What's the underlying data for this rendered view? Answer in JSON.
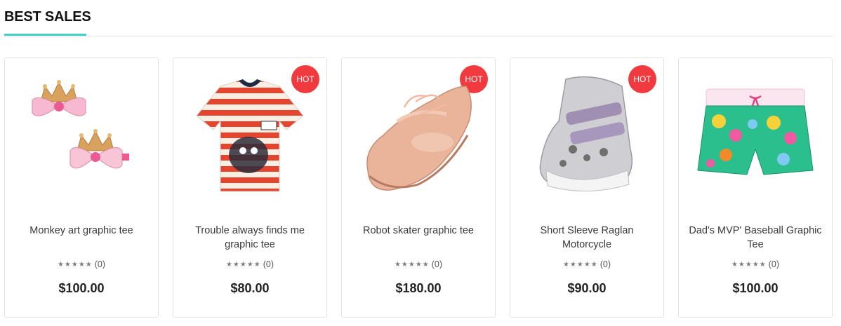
{
  "section": {
    "title": "BEST SALES"
  },
  "products": [
    {
      "name": "Monkey art graphic tee",
      "rating": "★★★★★",
      "count": "(0)",
      "price": "$100.00",
      "badge": ""
    },
    {
      "name": "Trouble always finds me graphic tee",
      "rating": "★★★★★",
      "count": "(0)",
      "price": "$80.00",
      "badge": "HOT"
    },
    {
      "name": "Robot skater graphic tee",
      "rating": "★★★★★",
      "count": "(0)",
      "price": "$180.00",
      "badge": "HOT"
    },
    {
      "name": "Short Sleeve Raglan Motorcycle",
      "rating": "★★★★★",
      "count": "(0)",
      "price": "$90.00",
      "badge": "HOT"
    },
    {
      "name": "Dad's MVP' Baseball Graphic Tee",
      "rating": "★★★★★",
      "count": "(0)",
      "price": "$100.00",
      "badge": ""
    }
  ],
  "colors": {
    "accent": "#3ed3c4",
    "hot": "#f13a3f"
  }
}
